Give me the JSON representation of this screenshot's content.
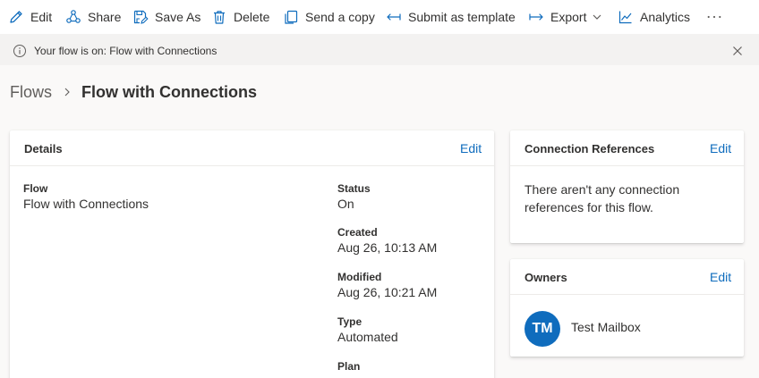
{
  "toolbar": {
    "edit": "Edit",
    "share": "Share",
    "save_as": "Save As",
    "delete": "Delete",
    "send_copy": "Send a copy",
    "submit_template": "Submit as template",
    "export": "Export",
    "analytics": "Analytics",
    "more": "···"
  },
  "message": {
    "text": "Your flow is on: Flow with Connections"
  },
  "breadcrumb": {
    "root": "Flows",
    "current": "Flow with Connections"
  },
  "details": {
    "title": "Details",
    "edit": "Edit",
    "flow_label": "Flow",
    "flow_value": "Flow with Connections",
    "status_label": "Status",
    "status_value": "On",
    "created_label": "Created",
    "created_value": "Aug 26, 10:13 AM",
    "modified_label": "Modified",
    "modified_value": "Aug 26, 10:21 AM",
    "type_label": "Type",
    "type_value": "Automated",
    "plan_label": "Plan"
  },
  "connection_refs": {
    "title": "Connection References",
    "edit": "Edit",
    "empty_text": "There aren't any connection references for this flow."
  },
  "owners": {
    "title": "Owners",
    "edit": "Edit",
    "items": [
      {
        "initials": "TM",
        "name": "Test Mailbox"
      }
    ]
  },
  "colors": {
    "accent": "#0f6cbd",
    "background": "#faf9f8",
    "toolbar_bg": "#ffffff",
    "message_bg": "#f3f2f1"
  }
}
